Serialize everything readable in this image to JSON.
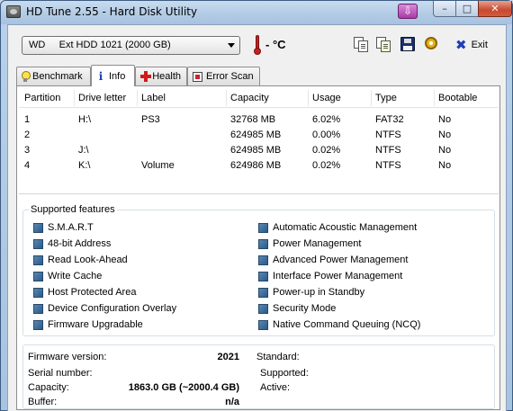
{
  "window": {
    "title": "HD Tune 2.55 - Hard Disk Utility",
    "minimize": "–",
    "maximize": "□",
    "close": "✕",
    "download_icon": "⇩"
  },
  "toolbar": {
    "drive_selected": "WD     Ext HDD 1021 (2000 GB)",
    "temperature": "- °C",
    "exit_label": "Exit",
    "exit_icon": "✖",
    "icons": [
      "copy-text-icon",
      "copy-screenshot-icon",
      "save-icon",
      "options-icon"
    ]
  },
  "tabs": [
    {
      "label": "Benchmark",
      "icon": "lightbulb-icon"
    },
    {
      "label": "Info",
      "icon": "info-icon",
      "active": true
    },
    {
      "label": "Health",
      "icon": "red-cross-icon"
    },
    {
      "label": "Error Scan",
      "icon": "error-scan-icon"
    }
  ],
  "partitions": {
    "columns": [
      "Partition",
      "Drive letter",
      "Label",
      "Capacity",
      "Usage",
      "Type",
      "Bootable"
    ],
    "rows": [
      [
        "1",
        "H:\\",
        "PS3",
        "32768 MB",
        "6.02%",
        "FAT32",
        "No"
      ],
      [
        "2",
        "",
        "",
        "624985 MB",
        "0.00%",
        "NTFS",
        "No"
      ],
      [
        "3",
        "J:\\",
        "",
        "624985 MB",
        "0.02%",
        "NTFS",
        "No"
      ],
      [
        "4",
        "K:\\",
        "Volume",
        "624986 MB",
        "0.02%",
        "NTFS",
        "No"
      ]
    ]
  },
  "features": {
    "title": "Supported features",
    "left": [
      "S.M.A.R.T",
      "48-bit Address",
      "Read Look-Ahead",
      "Write Cache",
      "Host Protected Area",
      "Device Configuration Overlay",
      "Firmware Upgradable"
    ],
    "right": [
      "Automatic Acoustic Management",
      "Power Management",
      "Advanced Power Management",
      "Interface Power Management",
      "Power-up in Standby",
      "Security Mode",
      "Native Command Queuing (NCQ)"
    ]
  },
  "details": {
    "firmware_label": "Firmware version:",
    "firmware_value": "2021",
    "serial_label": "Serial number:",
    "serial_value": "",
    "capacity_label": "Capacity:",
    "capacity_value": "1863.0 GB (~2000.4 GB)",
    "buffer_label": "Buffer:",
    "buffer_value": "n/a",
    "standard_label": "Standard:",
    "supported_label": "Supported:",
    "active_label": "Active:"
  }
}
